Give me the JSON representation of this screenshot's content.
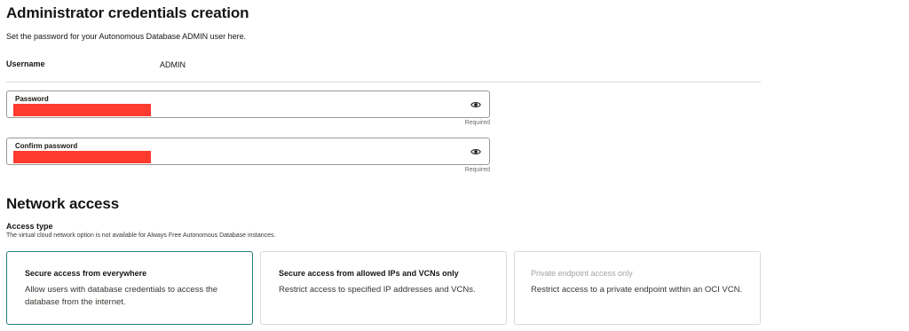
{
  "credentials": {
    "title": "Administrator credentials creation",
    "description": "Set the password for your Autonomous Database ADMIN user here.",
    "username_label": "Username",
    "username_value": "ADMIN",
    "password": {
      "label": "Password",
      "hint": "Required"
    },
    "confirm_password": {
      "label": "Confirm password",
      "hint": "Required"
    }
  },
  "network": {
    "title": "Network access",
    "access_type_label": "Access type",
    "access_type_note": "The virtual cloud network option is not available for Always Free Autonomous Database instances.",
    "options": [
      {
        "title": "Secure access from everywhere",
        "description": "Allow users with database credentials to access the database from the internet.",
        "selected": true
      },
      {
        "title": "Secure access from allowed IPs and VCNs only",
        "description": "Restrict access to specified IP addresses and VCNs.",
        "selected": false
      },
      {
        "title": "Private endpoint access only",
        "description": "Restrict access to a private endpoint within an OCI VCN.",
        "selected": false
      }
    ]
  },
  "colors": {
    "accent": "#227e7e",
    "redaction": "#ff3b2f",
    "border": "#9e9892"
  },
  "icons": [
    "eye-icon"
  ]
}
